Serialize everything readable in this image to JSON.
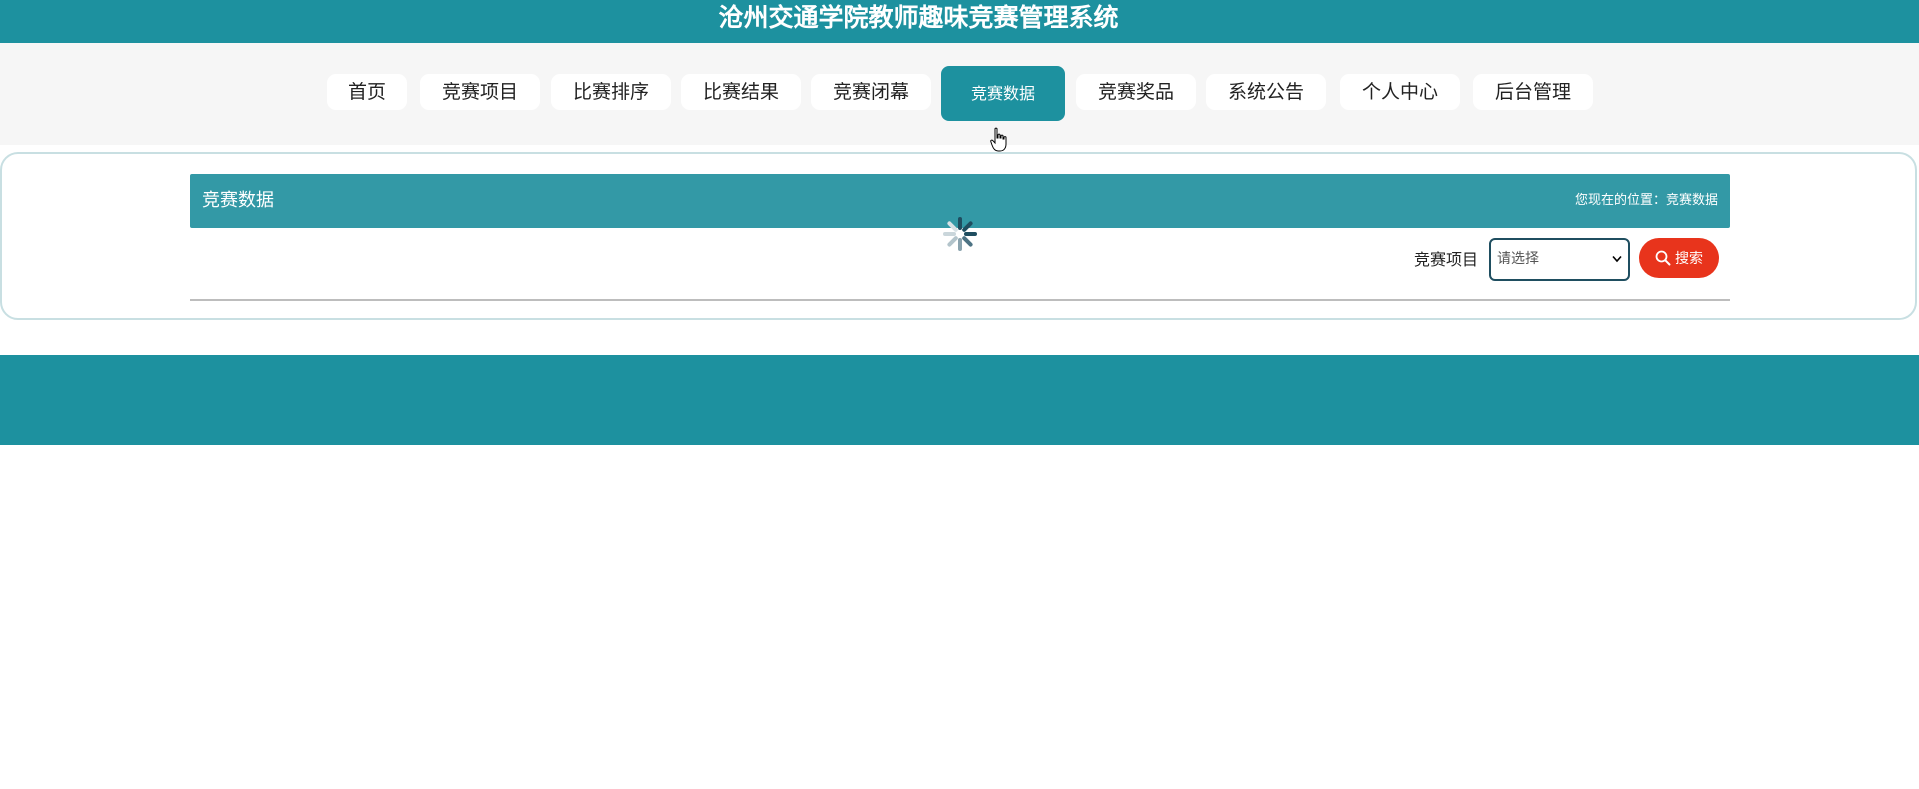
{
  "header": {
    "site_title": "沧州交通学院教师趣味竞赛管理系统"
  },
  "nav": {
    "items": [
      {
        "label": "首页",
        "active": false
      },
      {
        "label": "竞赛项目",
        "active": false
      },
      {
        "label": "比赛排序",
        "active": false
      },
      {
        "label": "比赛结果",
        "active": false
      },
      {
        "label": "竞赛闭幕",
        "active": false
      },
      {
        "label": "竞赛数据",
        "active": true
      },
      {
        "label": "竞赛奖品",
        "active": false
      },
      {
        "label": "系统公告",
        "active": false
      },
      {
        "label": "个人中心",
        "active": false
      },
      {
        "label": "后台管理",
        "active": false
      }
    ]
  },
  "section": {
    "title": "竞赛数据",
    "location": "您现在的位置：竞赛数据"
  },
  "filter": {
    "label": "竞赛项目",
    "select_value": "请选择"
  },
  "search": {
    "label": "搜索",
    "icon": "search-icon"
  },
  "loading": {
    "icon": "loading-spinner-icon"
  },
  "colors": {
    "primary": "#1d919f",
    "section_header": "#3399a6",
    "search_button": "#e8341c",
    "nav_band": "#f6f6f6"
  }
}
